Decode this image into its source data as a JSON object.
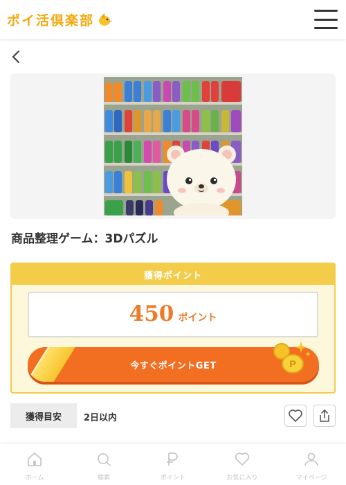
{
  "header": {
    "logo_text": "ポイ活倶楽部"
  },
  "game": {
    "title": "商品整理ゲーム：3Dパズル"
  },
  "points": {
    "heading": "獲得ポイント",
    "value": "450",
    "unit": "ポイント",
    "cta_label": "今すぐポイントGET"
  },
  "meta": {
    "label": "獲得目安",
    "value": "2日以内"
  },
  "colors": {
    "brand": "#f5a70a",
    "accent": "#f26f22",
    "gold": "#f3cc4a"
  },
  "nav": [
    {
      "label": "ホーム",
      "icon": "home-icon"
    },
    {
      "label": "検索",
      "icon": "search-icon"
    },
    {
      "label": "ポイント",
      "icon": "point-icon"
    },
    {
      "label": "お気に入り",
      "icon": "heart-icon"
    },
    {
      "label": "マイページ",
      "icon": "user-icon"
    }
  ]
}
